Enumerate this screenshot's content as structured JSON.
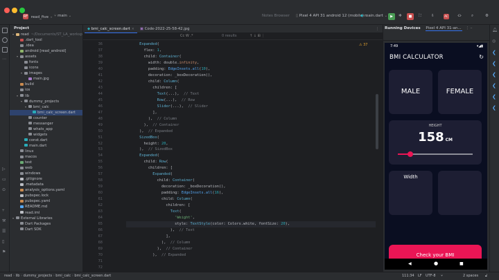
{
  "titlebar": {
    "project_badge": "RF",
    "project_name": "read_five",
    "branch": "main",
    "center_hint": "Notes Browser",
    "device": "Pixel 4 API 31 android 12 (mobile)",
    "run_config": "main.dart",
    "rec_badge": "AC"
  },
  "project": {
    "header": "Project",
    "tree": [
      {
        "label": "read",
        "suffix": "~/Documents/ST_LA_workspace"
      },
      {
        "label": ".dart_tool",
        "suffix": ""
      },
      {
        "label": ".idea",
        "suffix": ""
      },
      {
        "label": "android [read_android]",
        "suffix": ""
      },
      {
        "label": "assets",
        "suffix": ""
      },
      {
        "label": "fonts",
        "suffix": ""
      },
      {
        "label": "icons",
        "suffix": ""
      },
      {
        "label": "images",
        "suffix": ""
      },
      {
        "label": "main.jpg",
        "suffix": ""
      },
      {
        "label": "build",
        "suffix": ""
      },
      {
        "label": "ios",
        "suffix": ""
      },
      {
        "label": "lib",
        "suffix": ""
      },
      {
        "label": "dummy_projects",
        "suffix": ""
      },
      {
        "label": "bmi_calc",
        "suffix": ""
      },
      {
        "label": "bmi_calc_screen.dart",
        "suffix": ""
      },
      {
        "label": "counter",
        "suffix": ""
      },
      {
        "label": "messanger",
        "suffix": ""
      },
      {
        "label": "whats_app",
        "suffix": ""
      },
      {
        "label": "widgets",
        "suffix": ""
      },
      {
        "label": "const.dart",
        "suffix": ""
      },
      {
        "label": "main.dart",
        "suffix": ""
      },
      {
        "label": "linux",
        "suffix": ""
      },
      {
        "label": "macos",
        "suffix": ""
      },
      {
        "label": "test",
        "suffix": ""
      },
      {
        "label": "web",
        "suffix": ""
      },
      {
        "label": "windows",
        "suffix": ""
      },
      {
        "label": ".gitignore",
        "suffix": ""
      },
      {
        "label": ".metadata",
        "suffix": ""
      },
      {
        "label": "analysis_options.yaml",
        "suffix": ""
      },
      {
        "label": "pubspec.lock",
        "suffix": ""
      },
      {
        "label": "pubspec.yaml",
        "suffix": ""
      },
      {
        "label": "README.md",
        "suffix": ""
      },
      {
        "label": "read.iml",
        "suffix": ""
      },
      {
        "label": "External Libraries",
        "suffix": ""
      },
      {
        "label": "Dart Packages",
        "suffix": ""
      },
      {
        "label": "Dart SDK",
        "suffix": ""
      }
    ]
  },
  "editor": {
    "tabs": [
      "bmi_calc_screen.dart",
      "Code-2022-25-58-42.jpg"
    ],
    "find_results": "0 results",
    "warnings": "37",
    "line_numbers": [
      "36",
      "37",
      "38",
      "39",
      "40",
      "41",
      "42",
      "43",
      "44",
      "45",
      "46",
      "47",
      "48",
      "49",
      "50",
      "51",
      "52",
      "53",
      "54",
      "55",
      "56",
      "57",
      "58",
      "59",
      "60",
      "61",
      "62",
      "63",
      "64",
      "65",
      "66",
      "67",
      "68",
      "69",
      "70",
      "71",
      "72"
    ]
  },
  "devices": {
    "header": "Running Devices",
    "tab": "Pixel 4 API 31-an..."
  },
  "phone": {
    "time": "7:49",
    "title": "BMI CALCULATOR",
    "male": "MALE",
    "female": "FEMALE",
    "height_label": "HEIGHT",
    "height_value": "158",
    "height_unit": "CM",
    "slider_fraction": 0.17,
    "weight_label": "Width",
    "button": "Check your BMI"
  },
  "status": {
    "breadcrumb": [
      "read",
      "lib",
      "dummy_projects",
      "bmi_calc",
      "bmi_calc_screen.dart"
    ],
    "position": "111:34",
    "line_sep": "LF",
    "encoding": "UTF-8",
    "indent": "2 spaces"
  },
  "colors": {
    "accent": "#3574f0",
    "pink": "#eb1555",
    "card": "#1d1e33",
    "phone_bg": "#0a0e21"
  }
}
